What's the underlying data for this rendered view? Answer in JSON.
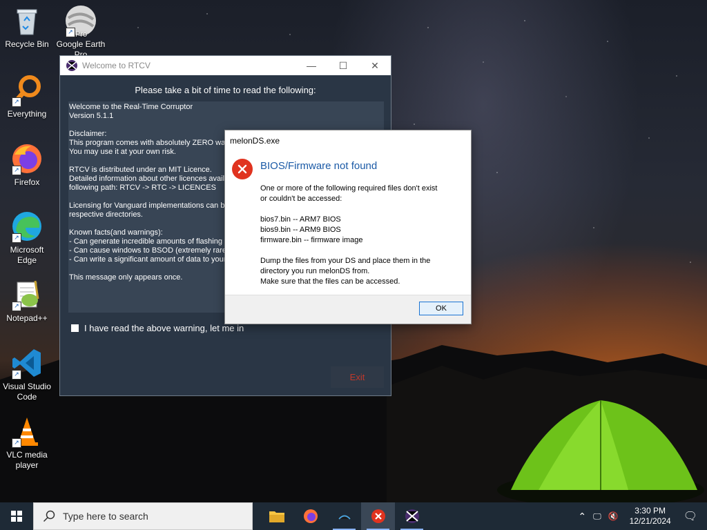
{
  "desktop": {
    "icons": [
      {
        "label": "Recycle Bin"
      },
      {
        "label": "Google Earth Pro"
      },
      {
        "label": "Everything"
      },
      {
        "label": "Firefox"
      },
      {
        "label": "Microsoft Edge"
      },
      {
        "label": "Notepad++"
      },
      {
        "label": "Visual Studio Code"
      },
      {
        "label": "VLC media player"
      }
    ],
    "ge_badge": "Pro"
  },
  "rtcv": {
    "title": "Welcome to RTCV",
    "heading": "Please take a bit of time to read the following:",
    "lines": [
      "Welcome to the Real-Time Corruptor",
      "Version 5.1.1",
      "",
      "Disclaimer:",
      "This program comes with absolutely ZERO warranty.",
      "You may use it at your own risk.",
      "",
      "RTCV is distributed under an MIT Licence.",
      "Detailed information about other licences available in the",
      "following path: RTCV -> RTC -> LICENCES",
      "",
      "Licensing for Vanguard implementations can be found in their",
      "respective directories.",
      "",
      "Known facts(and warnings):",
      "- Can generate incredible amounts of flashing and loud noises",
      "- Can cause windows to BSOD (extremely rare)",
      "- Can write a significant amount of data to your hard drive",
      "",
      "This message only appears once."
    ],
    "checkbox_label": "I have read the above warning, let me in",
    "exit_label": "Exit"
  },
  "dialog": {
    "title": "melonDS.exe",
    "main_instruction": "BIOS/Firmware not found",
    "content_lines": [
      "One or more of the following required files don't exist",
      "or couldn't be accessed:",
      "",
      "bios7.bin -- ARM7 BIOS",
      "bios9.bin -- ARM9 BIOS",
      "firmware.bin -- firmware image",
      "",
      "Dump the files from your DS and place them in the",
      "directory you run melonDS from.",
      "Make sure that the files can be accessed."
    ],
    "ok_label": "OK"
  },
  "taskbar": {
    "search_placeholder": "Type here to search",
    "time": "3:30 PM",
    "date": "12/21/2024"
  },
  "colors": {
    "taskbar": "#1e2a36",
    "rtcv_bg": "#2a3645",
    "error_red": "#e0331f",
    "dialog_link_blue": "#1b5aa6"
  }
}
